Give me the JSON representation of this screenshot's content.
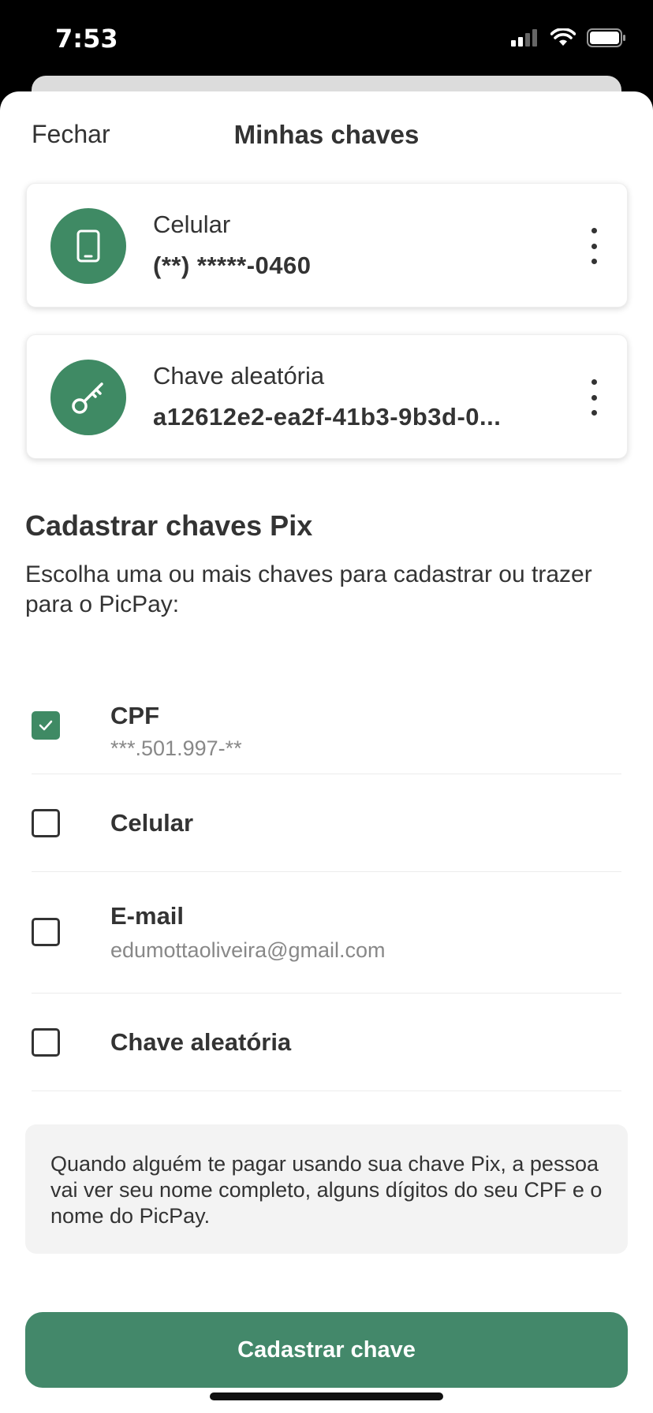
{
  "status_bar": {
    "time": "7:53"
  },
  "header": {
    "close_label": "Fechar",
    "title": "Minhas chaves"
  },
  "keys": [
    {
      "type": "Celular",
      "value": "(**) *****-0460",
      "icon": "phone-icon"
    },
    {
      "type": "Chave aleatória",
      "value": "a12612e2-ea2f-41b3-9b3d-0...",
      "icon": "key-icon"
    }
  ],
  "register": {
    "title": "Cadastrar chaves Pix",
    "description": "Escolha uma ou mais chaves para cadastrar ou trazer para o PicPay:",
    "options": [
      {
        "label": "CPF",
        "sub": "***.501.997-**",
        "checked": true
      },
      {
        "label": "Celular",
        "sub": "",
        "checked": false
      },
      {
        "label": "E-mail",
        "sub": "edumottaoliveira@gmail.com",
        "checked": false
      },
      {
        "label": "Chave aleatória",
        "sub": "",
        "checked": false
      }
    ]
  },
  "info": {
    "text": "Quando alguém te pagar usando sua chave Pix, a pessoa vai ver seu nome completo, alguns dígitos do seu CPF e o nome do PicPay."
  },
  "cta": {
    "label": "Cadastrar chave"
  },
  "colors": {
    "brand_green": "#43886a"
  }
}
